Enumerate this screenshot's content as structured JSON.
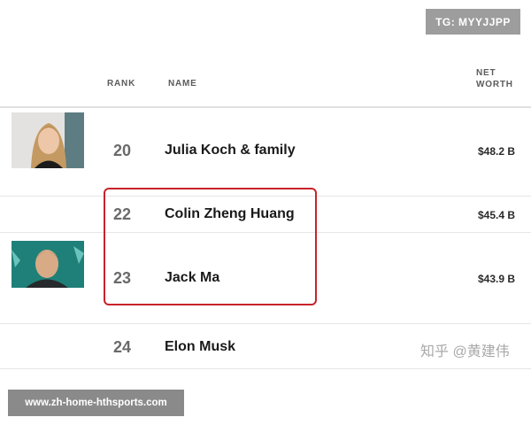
{
  "badges": {
    "telegram": "TG: MYYJJPP",
    "url": "www.zh-home-hthsports.com",
    "watermark": "知乎 @黄建伟"
  },
  "table": {
    "columns": {
      "rank": "RANK",
      "name": "NAME",
      "worth_line1": "NET",
      "worth_line2": "WORTH"
    },
    "rows": [
      {
        "rank": "20",
        "name": "Julia Koch & family",
        "net_worth": "$48.2 B"
      },
      {
        "rank": "22",
        "name": "Colin Zheng Huang",
        "net_worth": "$45.4 B"
      },
      {
        "rank": "23",
        "name": "Jack Ma",
        "net_worth": "$43.9 B"
      },
      {
        "rank": "24",
        "name": "Elon Musk",
        "net_worth": ""
      }
    ]
  },
  "colors": {
    "highlight": "#c8232c",
    "badge_bg": "#9d9d9d"
  }
}
